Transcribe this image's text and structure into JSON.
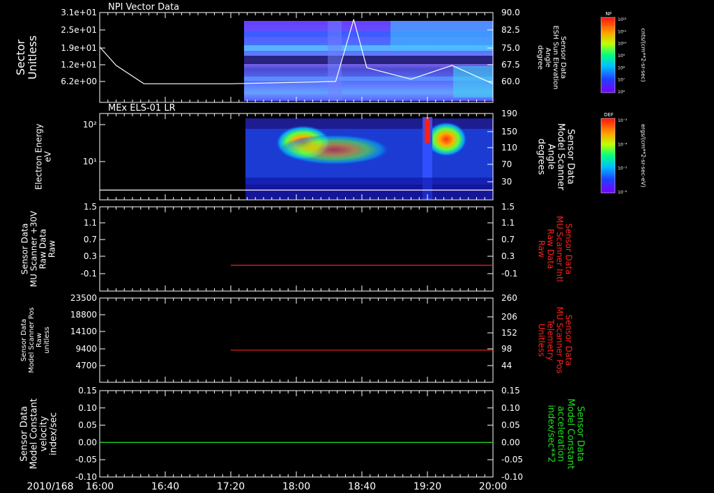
{
  "date_label": "2010/168",
  "x_ticks": [
    "16:00",
    "16:40",
    "17:20",
    "18:00",
    "18:40",
    "19:20",
    "20:00"
  ],
  "colorbars": [
    {
      "badge": "NF",
      "units": "cnts/(cm**2-sr-sec)",
      "ticks": [
        "10¹²",
        "10¹¹",
        "10¹⁰",
        "10⁹",
        "10⁸",
        "10⁷",
        "10⁶"
      ]
    },
    {
      "badge": "DEF",
      "units": "ergs/(cm**2-sr-sec-eV)",
      "ticks": [
        "10⁻³",
        "10⁻⁴",
        "10⁻⁵",
        "10⁻⁶"
      ]
    }
  ],
  "panels": [
    {
      "title": "NPI Vector Data",
      "left_label": [
        "Sector",
        "Unitless"
      ],
      "left_ticks": [
        "3.1e+01",
        "2.5e+01",
        "1.9e+01",
        "1.2e+01",
        "6.2e+00"
      ],
      "right_label": [
        "Sensor Data",
        "ESH Sun Elevation",
        "Angle",
        "degree"
      ],
      "right_ticks": [
        "90.0",
        "82.5",
        "75.0",
        "67.5",
        "60.0"
      ]
    },
    {
      "title": "MEx ELS-01 LR",
      "left_label": [
        "Electron Energy",
        "eV"
      ],
      "left_ticks": [
        "10²",
        "10¹"
      ],
      "right_label": [
        "Sensor Data",
        "Model Scanner",
        "Angle",
        "degrees"
      ],
      "right_ticks": [
        "190",
        "150",
        "110",
        "70",
        "30"
      ]
    },
    {
      "title": "",
      "left_label": [
        "Sensor Data",
        "MU Scanner +30V",
        "Raw Data",
        "Raw"
      ],
      "left_ticks": [
        "1.5",
        "1.1",
        "0.7",
        "0.3",
        "-0.1"
      ],
      "right_label": [
        "Sensor Data",
        "MU Scanner Intl",
        "Raw Data",
        "Raw"
      ],
      "right_ticks": [
        "1.5",
        "1.1",
        "0.7",
        "0.3",
        "-0.1"
      ]
    },
    {
      "title": "",
      "left_label": [
        "Sensor Data",
        "Model Scanner Pos",
        "Raw",
        "unitless"
      ],
      "left_ticks": [
        "23500",
        "18800",
        "14100",
        "9400",
        "4700"
      ],
      "right_label": [
        "Sensor Data",
        "MU Scanner Pos",
        "Telemetry",
        "Unitless"
      ],
      "right_ticks": [
        "260",
        "206",
        "152",
        "98",
        "44"
      ]
    },
    {
      "title": "",
      "left_label": [
        "Sensor Data",
        "Model Constant",
        "velocity",
        "index/sec"
      ],
      "left_ticks": [
        "0.15",
        "0.10",
        "0.05",
        "0.00",
        "-0.05",
        "-0.10"
      ],
      "right_label": [
        "Sensor Data",
        "Model Constant",
        "acceleration",
        "index/sec**2"
      ],
      "right_ticks": [
        "0.15",
        "0.10",
        "0.05",
        "0.00",
        "-0.05",
        "-0.10"
      ]
    }
  ],
  "colors": {
    "red": "#ff2020",
    "green": "#20e020",
    "white": "#ffffff"
  },
  "chart_data": {
    "type": "line",
    "x_range": [
      "16:00",
      "20:00"
    ],
    "series": [
      {
        "panel": 1,
        "x": [
          "16:00",
          "16:10",
          "16:27",
          "17:20",
          "18:24",
          "18:35",
          "18:43",
          "19:10",
          "19:35",
          "20:00"
        ],
        "y": [
          75,
          67,
          59,
          59,
          60,
          87,
          66,
          61,
          67,
          59
        ]
      },
      {
        "panel": 2,
        "x": [
          "16:00",
          "20:00"
        ],
        "y": [
          10,
          10
        ]
      },
      {
        "panel": 3,
        "x": [
          "17:20",
          "20:00"
        ],
        "y": [
          0.1,
          0.1
        ]
      },
      {
        "panel": 4,
        "x": [
          "17:20",
          "20:00"
        ],
        "y": [
          9000,
          9000
        ]
      },
      {
        "panel": 5,
        "x": [
          "16:00",
          "20:00"
        ],
        "y": [
          0,
          0
        ]
      }
    ]
  }
}
